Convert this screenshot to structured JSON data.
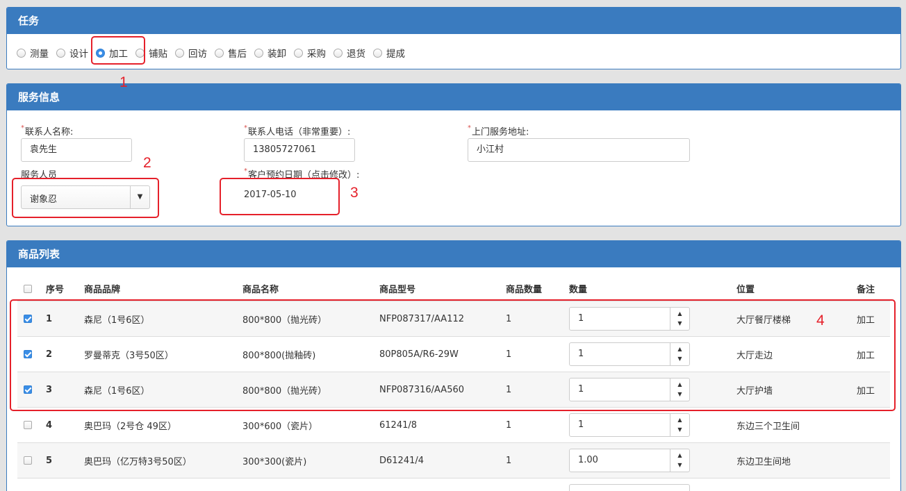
{
  "task_panel": {
    "title": "任务",
    "options": [
      {
        "label": "测量",
        "checked": false
      },
      {
        "label": "设计",
        "checked": false
      },
      {
        "label": "加工",
        "checked": true
      },
      {
        "label": "铺贴",
        "checked": false
      },
      {
        "label": "回访",
        "checked": false
      },
      {
        "label": "售后",
        "checked": false
      },
      {
        "label": "装卸",
        "checked": false
      },
      {
        "label": "采购",
        "checked": false
      },
      {
        "label": "退货",
        "checked": false
      },
      {
        "label": "提成",
        "checked": false
      }
    ]
  },
  "service_panel": {
    "title": "服务信息",
    "contact_name": {
      "label": "联系人名称:",
      "value": "袁先生"
    },
    "contact_phone": {
      "label": "联系人电话（非常重要）:",
      "value": "13805727061"
    },
    "address": {
      "label": "上门服务地址:",
      "value": "小江村"
    },
    "staff": {
      "label": "服务人员",
      "value": "谢象忍"
    },
    "appointment_date": {
      "label": "客户预约日期（点击修改）:",
      "value": "2017-05-10"
    }
  },
  "product_panel": {
    "title": "商品列表",
    "headers": {
      "seq": "序号",
      "brand": "商品品牌",
      "name": "商品名称",
      "model": "商品型号",
      "stock_qty": "商品数量",
      "qty": "数量",
      "location": "位置",
      "remark": "备注"
    },
    "rows": [
      {
        "checked": true,
        "seq": "1",
        "brand": "森尼（1号6区）",
        "name": "800*800（抛光砖）",
        "model": "NFP087317/AA112",
        "stock_qty": "1",
        "qty": "1",
        "location": "大厅餐厅楼梯",
        "remark": "加工"
      },
      {
        "checked": true,
        "seq": "2",
        "brand": "罗曼蒂克（3号50区）",
        "name": "800*800(抛釉砖)",
        "model": "80P805A/R6-29W",
        "stock_qty": "1",
        "qty": "1",
        "location": "大厅走边",
        "remark": "加工"
      },
      {
        "checked": true,
        "seq": "3",
        "brand": "森尼（1号6区）",
        "name": "800*800（抛光砖）",
        "model": "NFP087316/AA560",
        "stock_qty": "1",
        "qty": "1",
        "location": "大厅护墙",
        "remark": "加工"
      },
      {
        "checked": false,
        "seq": "4",
        "brand": "奥巴玛（2号仓 49区）",
        "name": "300*600（瓷片）",
        "model": "61241/8",
        "stock_qty": "1",
        "qty": "1",
        "location": "东边三个卫生间",
        "remark": ""
      },
      {
        "checked": false,
        "seq": "5",
        "brand": "奥巴玛（亿万特3号50区）",
        "name": "300*300(瓷片)",
        "model": "D61241/4",
        "stock_qty": "1",
        "qty": "1.00",
        "location": "东边卫生间地",
        "remark": ""
      }
    ]
  },
  "annotations": [
    "1",
    "2",
    "3",
    "4"
  ],
  "colors": {
    "panel_header": "#3a7bbf",
    "annotation": "#e5202a",
    "checked": "#3b8ee6"
  },
  "icons": {
    "select_arrow": "caret-down-icon",
    "spinner": "spinner-arrows-icon"
  }
}
